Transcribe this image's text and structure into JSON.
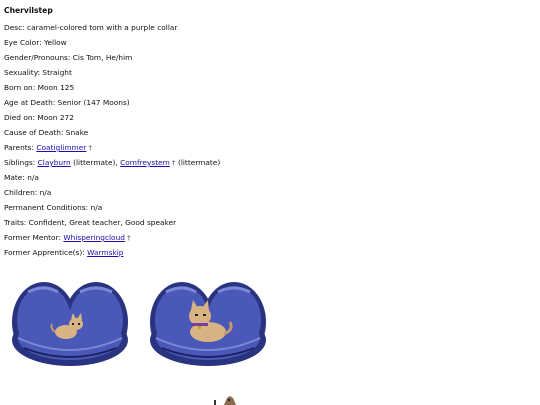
{
  "profile": {
    "name": "Chervilstep",
    "fields": {
      "desc": {
        "label": "Desc:",
        "value": "caramel-colored tom with a purple collar"
      },
      "eye_color": {
        "label": "Eye Color:",
        "value": "Yellow"
      },
      "gender": {
        "label": "Gender/Pronouns:",
        "value": "Cis Tom, He/him"
      },
      "sexuality": {
        "label": "Sexuality:",
        "value": "Straight"
      },
      "born": {
        "label": "Born on:",
        "value": "Moon 125"
      },
      "age_at_death": {
        "label": "Age at Death:",
        "value": "Senior (147 Moons)"
      },
      "died": {
        "label": "Died on:",
        "value": "Moon 272"
      },
      "cause_of_death": {
        "label": "Cause of Death:",
        "value": "Snake"
      },
      "parents": {
        "label": "Parents:",
        "link": "Coatiglimmer",
        "mark": "†"
      },
      "siblings": {
        "label": "Siblings:",
        "link1": "Clayburn",
        "note1": "(littermate),",
        "link2": "Comfreystem",
        "mark2": "†",
        "note2": "(littermate)"
      },
      "mate": {
        "label": "Mate:",
        "value": "n/a"
      },
      "children": {
        "label": "Children:",
        "value": "n/a"
      },
      "permanent_conditions": {
        "label": "Permanent Conditions:",
        "value": "n/a"
      },
      "traits": {
        "label": "Traits:",
        "value": "Confident, Great teacher, Good speaker"
      },
      "former_mentor": {
        "label": "Former Mentor:",
        "link": "Whisperingcloud",
        "mark": "†"
      },
      "former_apprentices": {
        "label": "Former Apprentice(s):",
        "link": "Warmskip"
      }
    }
  },
  "colors": {
    "link": "#1a0dab",
    "nest_dark": "#2a3380",
    "nest_mid": "#4a58b8",
    "nest_light": "#7b88d8",
    "cat_fur": "#d8b384",
    "collar": "#7a3fa0"
  },
  "sprites": [
    {
      "name": "kitten-sprite",
      "pose": "kitten"
    },
    {
      "name": "elder-sprite",
      "pose": "adult"
    }
  ]
}
